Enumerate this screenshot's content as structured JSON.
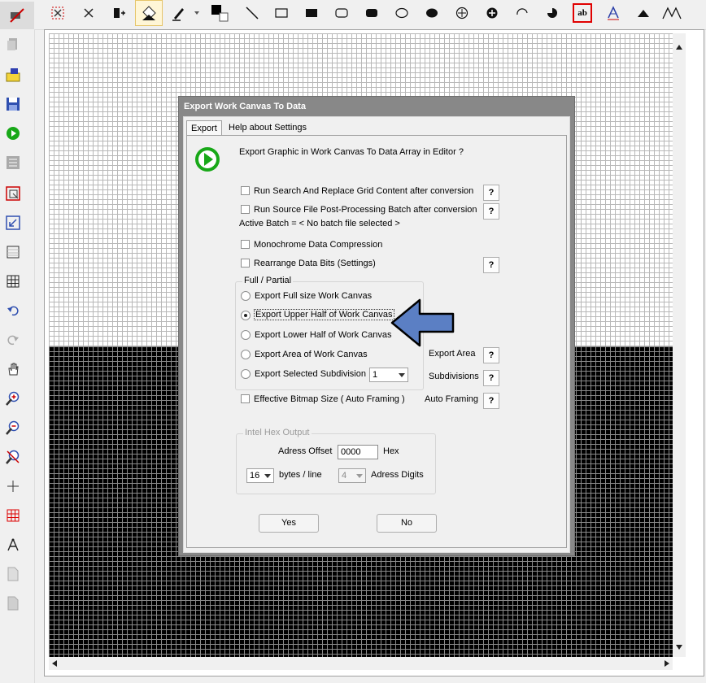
{
  "toolbar": {
    "icons": [
      "select-region-icon",
      "cross-icon",
      "insert-text-icon",
      "fill-icon",
      "pen-icon",
      "color-swap-icon",
      "line-icon",
      "rectangle-icon",
      "filled-rectangle-icon",
      "rounded-rectangle-icon",
      "filled-rounded-rectangle-icon",
      "ellipse-icon",
      "filled-ellipse-icon",
      "circle-cross-icon",
      "filled-circle-cross-icon",
      "arc-icon",
      "pie-icon",
      "text-ab-icon",
      "font-icon",
      "triangle-icon",
      "polyline-icon"
    ],
    "text_tool_label": "ab"
  },
  "sidebar": {
    "icons": [
      "clear-icon",
      "copy-icon",
      "open-folder-icon",
      "save-icon",
      "export-run-icon",
      "import-icon",
      "resize-icon",
      "transform-icon",
      "grid-icon",
      "table-icon",
      "undo-icon",
      "redo-icon",
      "hand-icon",
      "zoom-in-icon",
      "zoom-out-icon",
      "zoom-cancel-icon",
      "crosshair-icon",
      "red-grid-icon",
      "compass-icon",
      "page-icon",
      "page-blank-icon"
    ]
  },
  "dialog": {
    "title": "Export Work Canvas To Data",
    "tabs": [
      "Export",
      "Help about Settings"
    ],
    "prompt": "Export Graphic in Work Canvas To Data Array in Editor ?",
    "options": {
      "search_replace": "Run Search And Replace Grid Content after conversion",
      "post_processing": "Run Source File Post-Processing Batch after conversion",
      "active_batch": "Active Batch = < No batch file selected >",
      "monochrome": "Monochrome Data Compression",
      "rearrange": "Rearrange Data Bits (Settings)",
      "effective_bitmap": "Effective Bitmap Size ( Auto Framing )"
    },
    "help_label": "?",
    "full_partial": {
      "title": "Full / Partial",
      "radios": [
        {
          "label": "Export Full size Work Canvas",
          "selected": false
        },
        {
          "label": "Export Upper Half of Work Canvas",
          "selected": true
        },
        {
          "label": "Export Lower Half of Work Canvas",
          "selected": false
        },
        {
          "label": "Export Area of Work Canvas",
          "selected": false
        },
        {
          "label": "Export Selected Subdivision",
          "selected": false
        }
      ],
      "subdivision_value": "1"
    },
    "side_labels": {
      "export_area": "Export Area",
      "subdivisions": "Subdivisions",
      "auto_framing": "Auto Framing"
    },
    "intel_hex": {
      "title": "Intel Hex Output",
      "address_offset_label": "Adress Offset",
      "address_offset_value": "0000",
      "hex_label": "Hex",
      "bytes_value": "16",
      "bytes_label": "bytes / line",
      "digits_value": "4",
      "digits_label": "Adress Digits"
    },
    "buttons": {
      "yes": "Yes",
      "no": "No"
    }
  },
  "colors": {
    "arrow_fill": "#5b7fc4",
    "accent_red": "#e00000",
    "run_green": "#18a818"
  }
}
